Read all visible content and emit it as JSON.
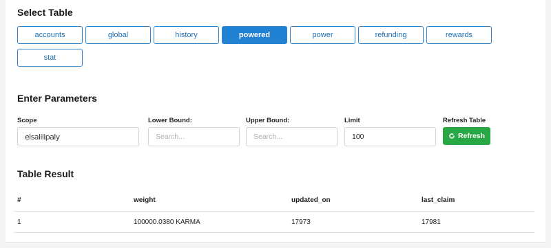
{
  "select_table": {
    "heading": "Select Table",
    "tables": [
      {
        "label": "accounts",
        "active": false
      },
      {
        "label": "global",
        "active": false
      },
      {
        "label": "history",
        "active": false
      },
      {
        "label": "powered",
        "active": true
      },
      {
        "label": "power",
        "active": false
      },
      {
        "label": "refunding",
        "active": false
      },
      {
        "label": "rewards",
        "active": false
      },
      {
        "label": "stat",
        "active": false
      }
    ]
  },
  "parameters": {
    "heading": "Enter Parameters",
    "scope": {
      "label": "Scope",
      "value": "elsalilipaly"
    },
    "lower_bound": {
      "label": "Lower Bound:",
      "placeholder": "Search..."
    },
    "upper_bound": {
      "label": "Upper Bound:",
      "placeholder": "Search..."
    },
    "limit": {
      "label": "Limit",
      "value": "100"
    },
    "refresh": {
      "label": "Refresh Table",
      "button_label": "Refresh",
      "icon": "refresh-icon"
    }
  },
  "result": {
    "heading": "Table Result",
    "columns": [
      "#",
      "weight",
      "updated_on",
      "last_claim"
    ],
    "rows": [
      [
        "1",
        "100000.0380 KARMA",
        "17973",
        "17981"
      ]
    ]
  },
  "colors": {
    "primary": "#2182d4",
    "success": "#28a745"
  }
}
